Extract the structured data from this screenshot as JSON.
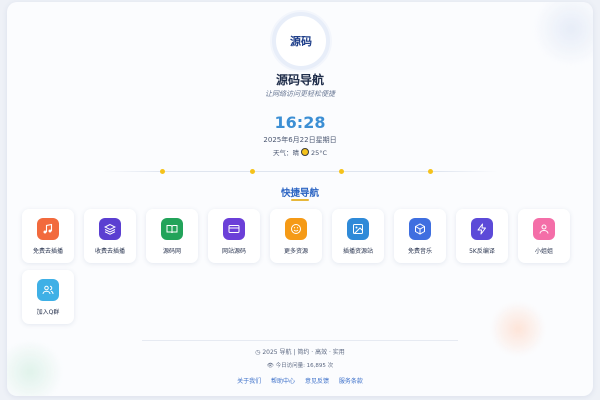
{
  "site": {
    "logo_text": "源码",
    "title": "源码导航",
    "subtitle": "让网络访问更轻松便捷"
  },
  "clock": {
    "time": "16:28",
    "date": "2025年6月22日星期日",
    "weather_label": "天气：",
    "weather_condition": "晴",
    "weather_temp": "25°C"
  },
  "quick_nav": {
    "title": "快捷导航",
    "items": [
      {
        "label": "免费去插播",
        "icon": "music-note-icon",
        "color": "#f26a3d"
      },
      {
        "label": "收费去插播",
        "icon": "layers-icon",
        "color": "#5b3fd1"
      },
      {
        "label": "源码网",
        "icon": "book-open-icon",
        "color": "#22a35a"
      },
      {
        "label": "网站源码",
        "icon": "credit-card-icon",
        "color": "#6b3fd8"
      },
      {
        "label": "更多资源",
        "icon": "smile-icon",
        "color": "#f59a16"
      },
      {
        "label": "插播资源站",
        "icon": "image-icon",
        "color": "#2f8ad8"
      },
      {
        "label": "免费音乐",
        "icon": "cube-icon",
        "color": "#3f6fe0"
      },
      {
        "label": "5K反编译",
        "icon": "lightning-icon",
        "color": "#5c4ad8"
      },
      {
        "label": "小姐姐",
        "icon": "person-icon",
        "color": "#f46ea8"
      },
      {
        "label": "加入Q群",
        "icon": "users-icon",
        "color": "#3fb0e6"
      }
    ]
  },
  "footer": {
    "copyright": "2025 导航 | 简约 · 高效 · 实用",
    "visits": "今日访问量: 16,895 次",
    "links": [
      "关于我们",
      "帮助中心",
      "意见反馈",
      "服务条款"
    ]
  },
  "colors": {
    "accent": "#3c8fd4",
    "section_title": "#2b64c3",
    "divider_dot": "#f5c21b"
  }
}
